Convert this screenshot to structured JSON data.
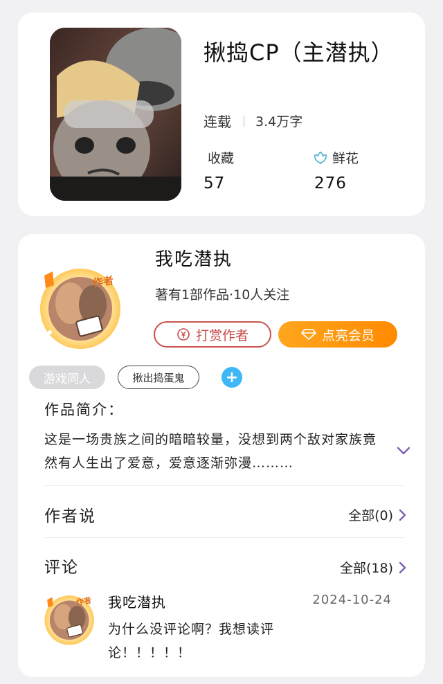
{
  "book": {
    "title": "揪捣CP（主潜执）",
    "status": "连载",
    "word_count": "3.4万字",
    "favorites_label": "收藏",
    "favorites_value": "57",
    "flowers_label": "鲜花",
    "flowers_value": "276",
    "flower_icon": "flower-outline-icon"
  },
  "author": {
    "name": "我吃潜执",
    "badge": "作者",
    "stats": "著有1部作品·10人关注",
    "tip_button": "打赏作者",
    "vip_button": "点亮会员",
    "tip_icon": "coin-icon",
    "vip_icon": "diamond-icon"
  },
  "tags": [
    "游戏同人",
    "揪出捣蛋鬼"
  ],
  "intro": {
    "title": "作品简介：",
    "text": "这是一场贵族之间的暗暗较量，没想到两个敌对家族竟然有人生出了爱意，爱意逐渐弥漫………"
  },
  "author_says": {
    "title": "作者说",
    "all_label": "全部(0)"
  },
  "comments": {
    "title": "评论",
    "all_label": "全部(18)",
    "items": [
      {
        "name": "我吃潜执",
        "badge": "作者",
        "time": "2024-10-24",
        "text": "为什么没评论啊？我想读评论！！！！！"
      }
    ]
  },
  "colors": {
    "tip_red": "#c44a45",
    "vip_orange": "#ff9512",
    "accent_purple": "#7b5fb8",
    "add_blue": "#3db8f4",
    "tag_grey": "#d9d9dc"
  }
}
